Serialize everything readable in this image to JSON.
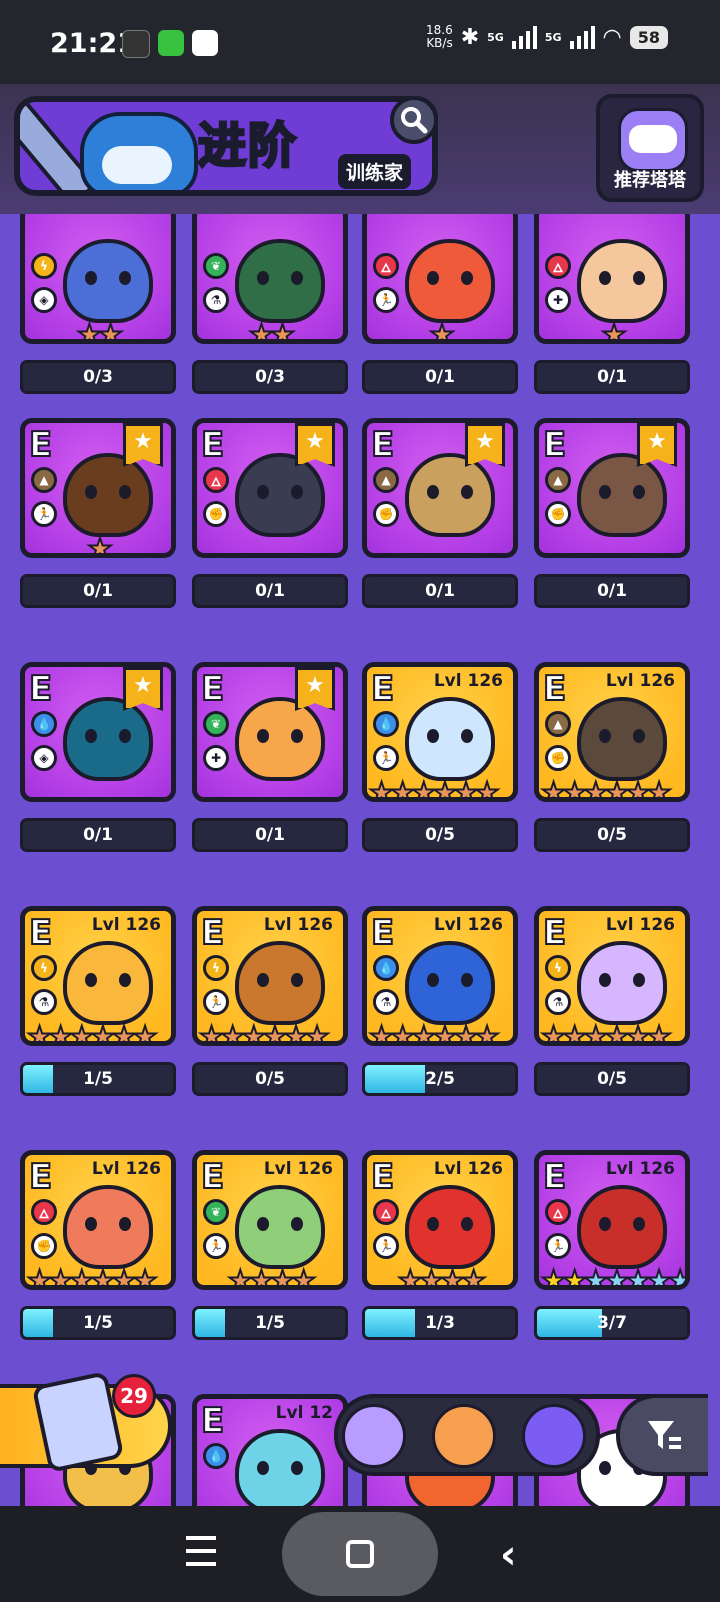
{
  "status": {
    "time": "21:21",
    "speed": "18.6",
    "speed_unit": "KB/s",
    "net1": "5G",
    "net2": "5G",
    "battery": "58"
  },
  "header": {
    "title": "进阶",
    "subtitle": "训练家",
    "recommend_label": "推荐塔塔"
  },
  "colors": {
    "fire": "#e8374a",
    "water": "#3b8fe8",
    "grass": "#34b35a",
    "thunder": "#f5b31a",
    "earth": "#8a6a44",
    "progress": "#2fb6e4"
  },
  "cards": [
    {
      "rank": "",
      "element": "thunder",
      "role": "shield",
      "gold": false,
      "flag": false,
      "level": "",
      "stars": 2,
      "progress": "0/3",
      "fill": 0,
      "creature": "#4b6fd6"
    },
    {
      "rank": "",
      "element": "grass",
      "role": "potion",
      "gold": false,
      "flag": false,
      "level": "",
      "stars": 2,
      "progress": "0/3",
      "fill": 0,
      "creature": "#2f6e47"
    },
    {
      "rank": "",
      "element": "fire",
      "role": "run",
      "gold": false,
      "flag": false,
      "level": "",
      "stars": 1,
      "progress": "0/1",
      "fill": 0,
      "creature": "#ef5a3a"
    },
    {
      "rank": "",
      "element": "fire",
      "role": "heal",
      "gold": false,
      "flag": false,
      "level": "",
      "stars": 1,
      "progress": "0/1",
      "fill": 0,
      "creature": "#f4c79c"
    },
    {
      "rank": "E",
      "element": "earth",
      "role": "run",
      "gold": false,
      "flag": true,
      "level": "",
      "stars": 1,
      "progress": "0/1",
      "fill": 0,
      "creature": "#6b3d1f"
    },
    {
      "rank": "E",
      "element": "fire",
      "role": "fist",
      "gold": false,
      "flag": true,
      "level": "",
      "stars": 0,
      "progress": "0/1",
      "fill": 0,
      "creature": "#3a3d52"
    },
    {
      "rank": "E",
      "element": "earth",
      "role": "fist",
      "gold": false,
      "flag": true,
      "level": "",
      "stars": 0,
      "progress": "0/1",
      "fill": 0,
      "creature": "#c9a05e"
    },
    {
      "rank": "E",
      "element": "earth",
      "role": "fist",
      "gold": false,
      "flag": true,
      "level": "",
      "stars": 0,
      "progress": "0/1",
      "fill": 0,
      "creature": "#7a5644"
    },
    {
      "rank": "E",
      "element": "water",
      "role": "shield",
      "gold": false,
      "flag": true,
      "level": "",
      "stars": 0,
      "progress": "0/1",
      "fill": 0,
      "creature": "#1a6b8a"
    },
    {
      "rank": "E",
      "element": "grass",
      "role": "heal",
      "gold": false,
      "flag": true,
      "level": "",
      "stars": 0,
      "progress": "0/1",
      "fill": 0,
      "creature": "#f7a64a"
    },
    {
      "rank": "E",
      "element": "water",
      "role": "run",
      "gold": true,
      "flag": false,
      "level": "Lvl 126",
      "stars": 6,
      "progress": "0/5",
      "fill": 0,
      "creature": "#cfe6ff"
    },
    {
      "rank": "E",
      "element": "earth",
      "role": "fist",
      "gold": true,
      "flag": false,
      "level": "Lvl 126",
      "stars": 6,
      "progress": "0/5",
      "fill": 0,
      "creature": "#5b4a3c"
    },
    {
      "rank": "E",
      "element": "thunder",
      "role": "potion",
      "gold": true,
      "flag": false,
      "level": "Lvl 126",
      "stars": 6,
      "progress": "1/5",
      "fill": 0.2,
      "creature": "#f9b73b"
    },
    {
      "rank": "E",
      "element": "thunder",
      "role": "run",
      "gold": true,
      "flag": false,
      "level": "Lvl 126",
      "stars": 6,
      "progress": "0/5",
      "fill": 0,
      "creature": "#c9782e"
    },
    {
      "rank": "E",
      "element": "water",
      "role": "potion",
      "gold": true,
      "flag": false,
      "level": "Lvl 126",
      "stars": 6,
      "progress": "2/5",
      "fill": 0.4,
      "creature": "#2e64d8"
    },
    {
      "rank": "E",
      "element": "thunder",
      "role": "potion",
      "gold": true,
      "flag": false,
      "level": "Lvl 126",
      "stars": 6,
      "progress": "0/5",
      "fill": 0,
      "creature": "#d6b7ff"
    },
    {
      "rank": "E",
      "element": "fire",
      "role": "fist",
      "gold": true,
      "flag": false,
      "level": "Lvl 126",
      "stars": 6,
      "progress": "1/5",
      "fill": 0.2,
      "creature": "#f07b5c"
    },
    {
      "rank": "E",
      "element": "grass",
      "role": "run",
      "gold": true,
      "flag": false,
      "level": "Lvl 126",
      "stars": 4,
      "progress": "1/5",
      "fill": 0.2,
      "creature": "#8fcf7a"
    },
    {
      "rank": "E",
      "element": "fire",
      "role": "run",
      "gold": true,
      "flag": false,
      "level": "Lvl 126",
      "stars": 4,
      "progress": "1/3",
      "fill": 0.33,
      "creature": "#e2322e"
    },
    {
      "rank": "E",
      "element": "fire",
      "role": "run",
      "gold": false,
      "flag": false,
      "level": "Lvl 126",
      "stars": 7,
      "stars_yellow": 2,
      "progress": "3/7",
      "fill": 0.43,
      "creature": "#c92f2a"
    },
    {
      "rank": "",
      "element": "",
      "role": "",
      "gold": false,
      "flag": false,
      "level": "",
      "stars": 0,
      "progress": "",
      "fill": 0,
      "creature": "#f2c04a"
    },
    {
      "rank": "E",
      "element": "water",
      "role": "",
      "gold": false,
      "flag": false,
      "level": "Lvl 12",
      "stars": 0,
      "progress": "",
      "fill": 0,
      "creature": "#6fd3e8"
    },
    {
      "rank": "",
      "element": "",
      "role": "",
      "gold": false,
      "flag": false,
      "level": "",
      "stars": 0,
      "progress": "",
      "fill": 0,
      "creature": "#f0662e"
    },
    {
      "rank": "",
      "element": "",
      "role": "",
      "gold": false,
      "flag": false,
      "level": "",
      "stars": 0,
      "progress": "",
      "fill": 0,
      "creature": "#ffffff"
    }
  ],
  "mystery_box": {
    "count": "29"
  },
  "tabs": [
    "cat-tab",
    "bread-tab",
    "spirit-tab"
  ]
}
